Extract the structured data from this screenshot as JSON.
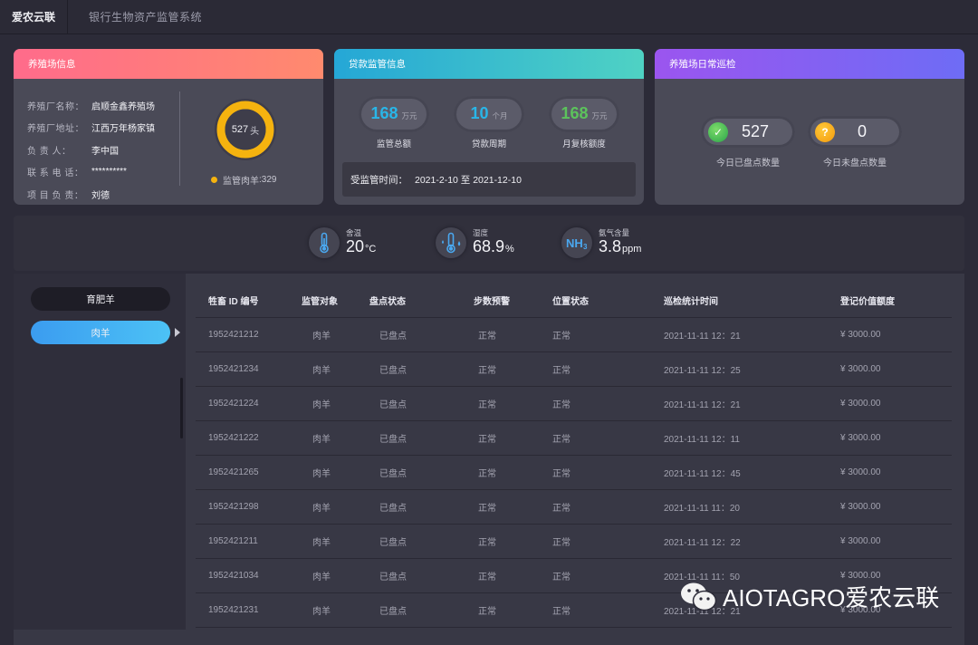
{
  "topbar": {
    "brand": "爱农云联",
    "system_title": "银行生物资产监管系统"
  },
  "farm_card": {
    "title": "养殖场信息",
    "rows": [
      {
        "label": "养殖厂名称：",
        "value": "启顺金鑫养殖场"
      },
      {
        "label": "养殖厂地址：",
        "value": "江西万年杨家镇"
      },
      {
        "label": "负  责  人：",
        "value": "李中国"
      },
      {
        "label": "联 系 电 话：",
        "value": "**********"
      },
      {
        "label": "项 目 负 责：",
        "value": "刘德"
      }
    ],
    "donut": {
      "total": "527",
      "unit": "头",
      "color": "#f5b30f",
      "fraction": 1.0
    },
    "legend": {
      "label": "监管肉羊",
      "value": ":329"
    }
  },
  "loan_card": {
    "title": "贷款监管信息",
    "stats": [
      {
        "value": "168",
        "unit": "万元",
        "caption": "监管总额",
        "color": "#29b6e8"
      },
      {
        "value": "10",
        "unit": "个月",
        "caption": "贷款周期",
        "color": "#29b6e8"
      },
      {
        "value": "168",
        "unit": "万元",
        "caption": "月复核额度",
        "color": "#5cc35c"
      }
    ],
    "period_label": "受监管时间：",
    "period_value": "2021-2-10 至 2021-12-10"
  },
  "patrol_card": {
    "title": "养殖场日常巡检",
    "checked": {
      "value": "527",
      "caption": "今日已盘点数量",
      "icon": "check-icon"
    },
    "unchecked": {
      "value": "0",
      "caption": "今日未盘点数量",
      "icon": "question-icon"
    }
  },
  "environment": [
    {
      "label": "舍温",
      "value": "20",
      "unit": "°C",
      "icon": "thermometer-icon"
    },
    {
      "label": "湿度",
      "value": "68.9",
      "unit": "%",
      "icon": "humidity-icon"
    },
    {
      "label": "氨气含量",
      "value": "3.8",
      "unit": "ppm",
      "icon": "nh3-icon"
    }
  ],
  "sidebar": {
    "items": [
      {
        "label": "育肥羊",
        "active": false
      },
      {
        "label": "肉羊",
        "active": true
      }
    ]
  },
  "table": {
    "headers": [
      "牲畜 ID 编号",
      "监管对象",
      "盘点状态",
      "步数预警",
      "位置状态",
      "巡检统计时间",
      "登记价值额度"
    ],
    "rows": [
      [
        "1952421212",
        "肉羊",
        "已盘点",
        "正常",
        "正常",
        "2021-11-11 12：21",
        "¥ 3000.00"
      ],
      [
        "1952421234",
        "肉羊",
        "已盘点",
        "正常",
        "正常",
        "2021-11-11 12：25",
        "¥ 3000.00"
      ],
      [
        "1952421224",
        "肉羊",
        "已盘点",
        "正常",
        "正常",
        "2021-11-11 12：21",
        "¥ 3000.00"
      ],
      [
        "1952421222",
        "肉羊",
        "已盘点",
        "正常",
        "正常",
        "2021-11-11 12：11",
        "¥ 3000.00"
      ],
      [
        "1952421265",
        "肉羊",
        "已盘点",
        "正常",
        "正常",
        "2021-11-11 12：45",
        "¥ 3000.00"
      ],
      [
        "1952421298",
        "肉羊",
        "已盘点",
        "正常",
        "正常",
        "2021-11-11 11：20",
        "¥ 3000.00"
      ],
      [
        "1952421211",
        "肉羊",
        "已盘点",
        "正常",
        "正常",
        "2021-11-11 12：22",
        "¥ 3000.00"
      ],
      [
        "1952421034",
        "肉羊",
        "已盘点",
        "正常",
        "正常",
        "2021-11-11 11：50",
        "¥ 3000.00"
      ],
      [
        "1952421231",
        "肉羊",
        "已盘点",
        "正常",
        "正常",
        "2021-11-11 12：21",
        "¥ 3000.00"
      ]
    ]
  },
  "watermark": {
    "text": "AIOTAGRO爱农云联"
  }
}
